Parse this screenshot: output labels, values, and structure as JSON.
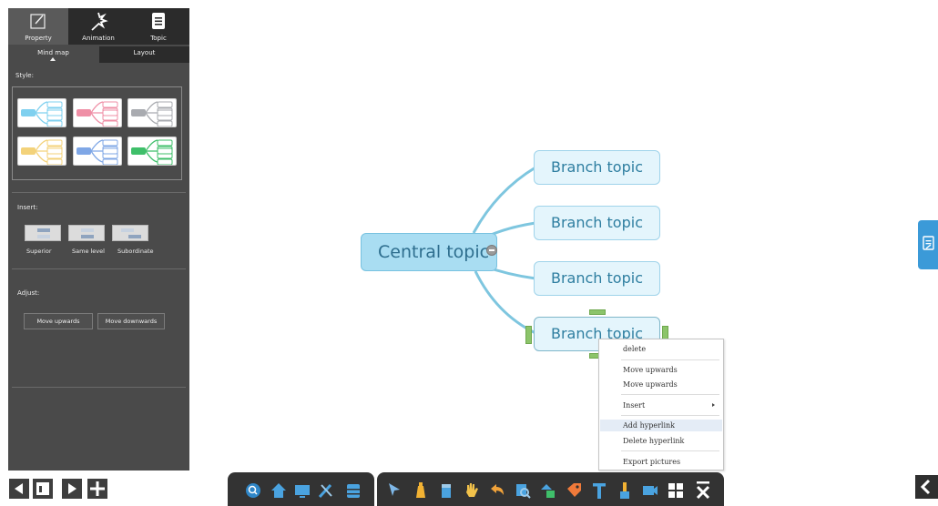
{
  "panel": {
    "tabs": [
      {
        "label": "Property",
        "icon": "property-icon",
        "active": true
      },
      {
        "label": "Animation",
        "icon": "magic-wand-icon",
        "active": false
      },
      {
        "label": "Topic",
        "icon": "document-icon",
        "active": false
      }
    ],
    "subtabs": [
      "Mind map",
      "Layout"
    ],
    "style_label": "Style:",
    "style_colors": [
      "#7fd0ef",
      "#ef8fa6",
      "#a9abb0",
      "#f3d27a",
      "#7fa7e6",
      "#3fbf6a"
    ],
    "insert_label": "Insert:",
    "insert_buttons": [
      "Superior",
      "Same level",
      "Subordinate"
    ],
    "adjust_label": "Adjust:",
    "adjust_buttons": [
      "Move upwards",
      "Move downwards"
    ]
  },
  "mindmap": {
    "central": "Central topic",
    "branches": [
      "Branch topic",
      "Branch topic",
      "Branch topic",
      "Branch topic"
    ]
  },
  "context_menu": {
    "items": [
      "delete",
      "Move upwards",
      "Move upwards",
      "Insert",
      "Add hyperlink",
      "Delete hyperlink",
      "Export pictures"
    ]
  },
  "colors": {
    "accent_blue": "#3b9ad8",
    "panel_bg": "#4a4a4a",
    "central_fill": "#a9ddf2",
    "branch_fill": "#e4f5fc",
    "handle_green": "#8cc46a"
  },
  "toolbar_icons": [
    "search-icon",
    "home-icon",
    "screen-icon",
    "pen-tool-icon",
    "database-icon",
    "pointer-icon",
    "highlighter-icon",
    "eraser-icon",
    "hand-icon",
    "undo-icon",
    "zoom-icon",
    "shapes-icon",
    "tag-icon",
    "text-icon",
    "brush-icon",
    "camera-icon",
    "grid-icon",
    "close-icon"
  ]
}
